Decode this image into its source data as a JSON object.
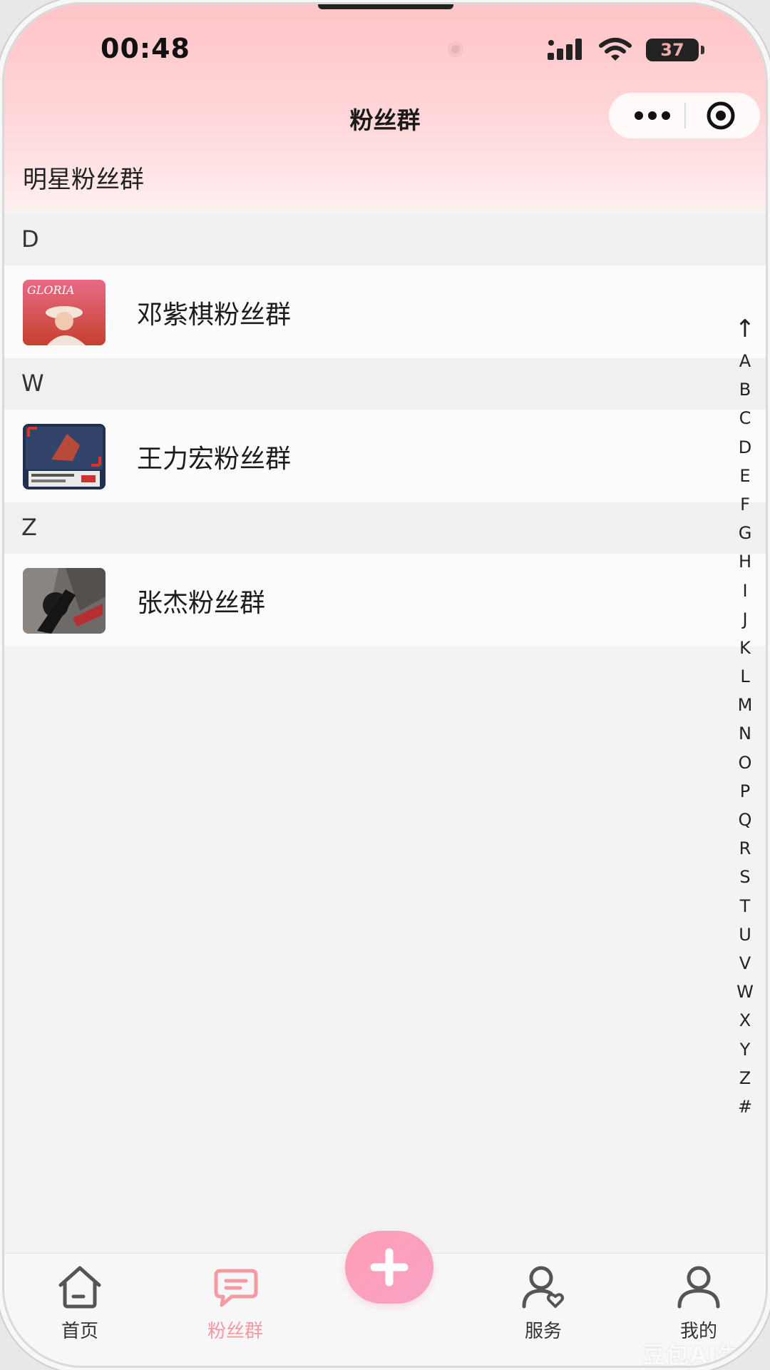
{
  "status_bar": {
    "time": "00:48",
    "battery": "37"
  },
  "header": {
    "title": "粉丝群",
    "section_heading": "明星粉丝群",
    "icons": [
      "more-icon",
      "target-icon"
    ]
  },
  "groups": [
    {
      "letter": "D",
      "name": "邓紫棋粉丝群",
      "thumb": "album-cover-pink"
    },
    {
      "letter": "W",
      "name": "王力宏粉丝群",
      "thumb": "album-cover-blue"
    },
    {
      "letter": "Z",
      "name": "张杰粉丝群",
      "thumb": "album-cover-dark"
    }
  ],
  "index_bar": {
    "up": "↑",
    "letters": [
      "A",
      "B",
      "C",
      "D",
      "E",
      "F",
      "G",
      "H",
      "I",
      "J",
      "K",
      "L",
      "M",
      "N",
      "O",
      "P",
      "Q",
      "R",
      "S",
      "T",
      "U",
      "V",
      "W",
      "X",
      "Y",
      "Z",
      "#"
    ]
  },
  "tabbar": {
    "home": "首页",
    "fans": "粉丝群",
    "service": "服务",
    "mine": "我的",
    "active_color": "#f39aa3"
  },
  "watermark": "豆包AI生成"
}
